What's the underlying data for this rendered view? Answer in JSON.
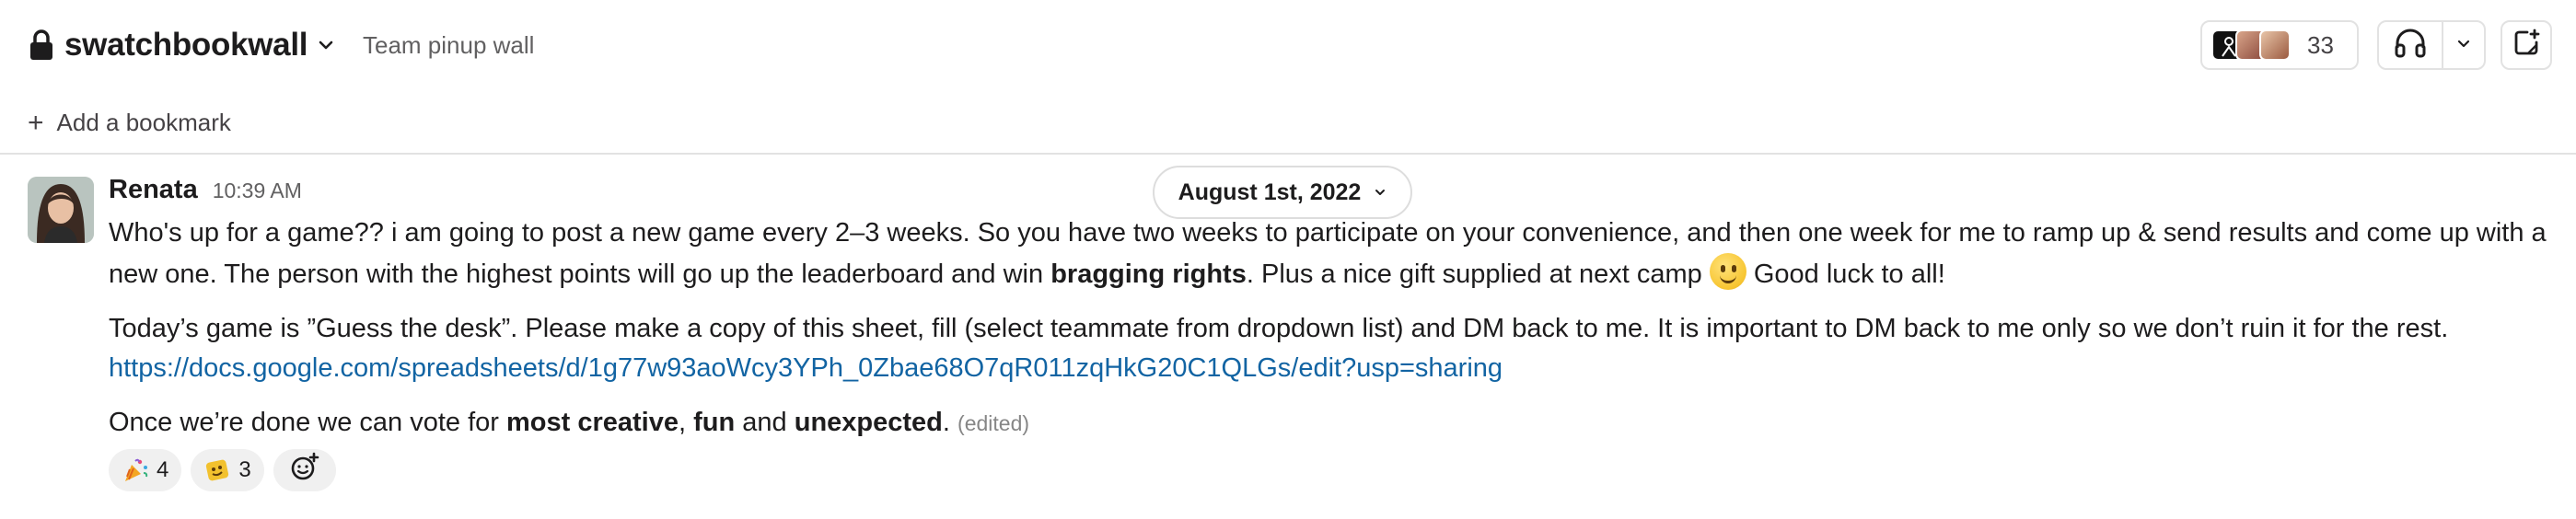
{
  "header": {
    "channel_name": "swatchbookwall",
    "topic": "Team pinup wall",
    "member_count": "33"
  },
  "bookmarks": {
    "add_label": "Add a bookmark"
  },
  "message": {
    "date_label": "August 1st, 2022",
    "author": "Renata",
    "time": "10:39 AM",
    "p1_a": "Who's up for a game?? i am going to post a new game every 2–3 weeks. So you have two weeks to participate on your convenience, and then one week for me to ramp up & send results and come up with a new one. The person with the highest points will go up the leaderboard and win ",
    "p1_bold": "bragging rights",
    "p1_b": ". Plus a nice gift supplied at next camp ",
    "p1_c": " Good luck to all!",
    "p2": "Today’s game is ”Guess the desk”. Please make a copy of this sheet, fill (select teammate from dropdown list) and DM back to me. It is important to DM back to me only so we don’t ruin it for the rest.",
    "p2_link": "https://docs.google.com/spreadsheets/d/1g77w93aoWcy3YPh_0Zbae68O7qR011zqHkG20C1QLGs/edit?usp=sharing",
    "p3_a": "Once we’re done we can vote for ",
    "p3_bold1": "most creative",
    "p3_sep1": ", ",
    "p3_bold2": "fun",
    "p3_sep2": " and ",
    "p3_bold3": "unexpected",
    "p3_end": ". ",
    "edited": "(edited)"
  },
  "reactions": [
    {
      "icon": "party-popper-icon",
      "count": "4"
    },
    {
      "icon": "custom-emoji-icon",
      "count": "3"
    }
  ],
  "colors": {
    "link": "#1264a3",
    "border": "#e2e2e2",
    "reaction_bg": "#f0f0f0"
  }
}
